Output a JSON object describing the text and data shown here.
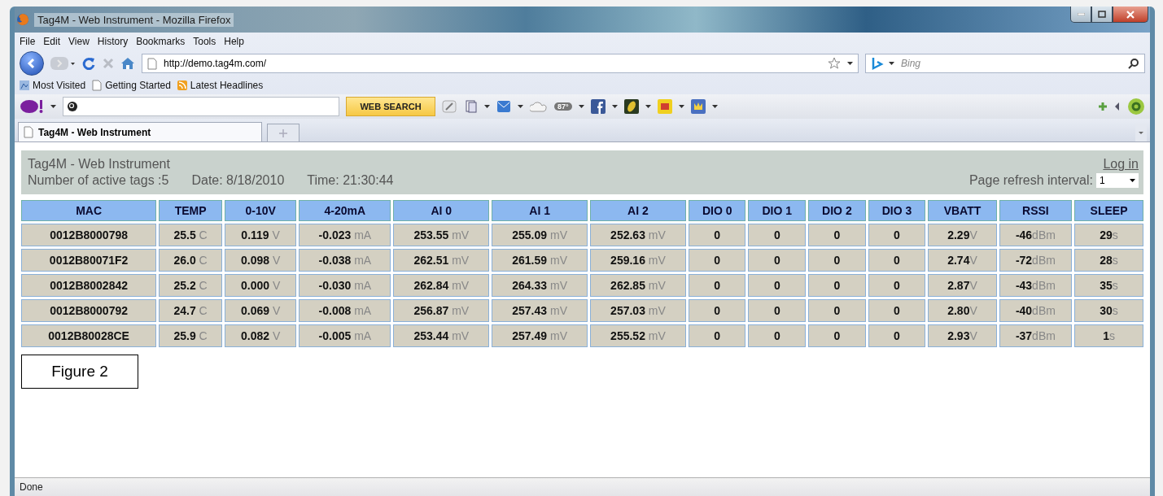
{
  "window": {
    "title": "Tag4M - Web Instrument - Mozilla Firefox"
  },
  "menu": [
    "File",
    "Edit",
    "View",
    "History",
    "Bookmarks",
    "Tools",
    "Help"
  ],
  "navigation": {
    "url": "http://demo.tag4m.com/",
    "search_placeholder": "Bing"
  },
  "bookmarks": [
    "Most Visited",
    "Getting Started",
    "Latest Headlines"
  ],
  "yahoo_toolbar": {
    "search_button": "WEB SEARCH",
    "weather": "87°"
  },
  "tabs": [
    {
      "label": "Tag4M - Web Instrument",
      "selected": true
    }
  ],
  "page": {
    "title": "Tag4M - Web Instrument",
    "active_tags": "Number of active tags :5",
    "date": "Date: 8/18/2010",
    "time": "Time: 21:30:44",
    "login": "Log in",
    "refresh_label": "Page refresh interval:",
    "refresh_value": "1"
  },
  "table": {
    "columns": [
      "MAC",
      "TEMP",
      "0-10V",
      "4-20mA",
      "AI 0",
      "AI 1",
      "AI 2",
      "DIO 0",
      "DIO 1",
      "DIO 2",
      "DIO 3",
      "VBATT",
      "RSSI",
      "SLEEP"
    ],
    "rows": [
      [
        {
          "value": "0012B8000798"
        },
        {
          "value": "25.5",
          "unit": "C"
        },
        {
          "value": "0.119",
          "unit": "V"
        },
        {
          "value": "-0.023",
          "unit": "mA"
        },
        {
          "value": "253.55",
          "unit": "mV"
        },
        {
          "value": "255.09",
          "unit": "mV"
        },
        {
          "value": "252.63",
          "unit": "mV"
        },
        {
          "value": "0"
        },
        {
          "value": "0"
        },
        {
          "value": "0"
        },
        {
          "value": "0"
        },
        {
          "value": "2.29",
          "unit": "V"
        },
        {
          "value": "-46",
          "unit": "dBm"
        },
        {
          "value": "29",
          "unit": "s"
        }
      ],
      [
        {
          "value": "0012B80071F2"
        },
        {
          "value": "26.0",
          "unit": "C"
        },
        {
          "value": "0.098",
          "unit": "V"
        },
        {
          "value": "-0.038",
          "unit": "mA"
        },
        {
          "value": "262.51",
          "unit": "mV"
        },
        {
          "value": "261.59",
          "unit": "mV"
        },
        {
          "value": "259.16",
          "unit": "mV"
        },
        {
          "value": "0"
        },
        {
          "value": "0"
        },
        {
          "value": "0"
        },
        {
          "value": "0"
        },
        {
          "value": "2.74",
          "unit": "V"
        },
        {
          "value": "-72",
          "unit": "dBm"
        },
        {
          "value": "28",
          "unit": "s"
        }
      ],
      [
        {
          "value": "0012B8002842"
        },
        {
          "value": "25.2",
          "unit": "C"
        },
        {
          "value": "0.000",
          "unit": "V"
        },
        {
          "value": "-0.030",
          "unit": "mA"
        },
        {
          "value": "262.84",
          "unit": "mV"
        },
        {
          "value": "264.33",
          "unit": "mV"
        },
        {
          "value": "262.85",
          "unit": "mV"
        },
        {
          "value": "0"
        },
        {
          "value": "0"
        },
        {
          "value": "0"
        },
        {
          "value": "0"
        },
        {
          "value": "2.87",
          "unit": "V"
        },
        {
          "value": "-43",
          "unit": "dBm"
        },
        {
          "value": "35",
          "unit": "s"
        }
      ],
      [
        {
          "value": "0012B8000792"
        },
        {
          "value": "24.7",
          "unit": "C"
        },
        {
          "value": "0.069",
          "unit": "V"
        },
        {
          "value": "-0.008",
          "unit": "mA"
        },
        {
          "value": "256.87",
          "unit": "mV"
        },
        {
          "value": "257.43",
          "unit": "mV"
        },
        {
          "value": "257.03",
          "unit": "mV"
        },
        {
          "value": "0"
        },
        {
          "value": "0"
        },
        {
          "value": "0"
        },
        {
          "value": "0"
        },
        {
          "value": "2.80",
          "unit": "V"
        },
        {
          "value": "-40",
          "unit": "dBm"
        },
        {
          "value": "30",
          "unit": "s"
        }
      ],
      [
        {
          "value": "0012B80028CE"
        },
        {
          "value": "25.9",
          "unit": "C"
        },
        {
          "value": "0.082",
          "unit": "V"
        },
        {
          "value": "-0.005",
          "unit": "mA"
        },
        {
          "value": "253.44",
          "unit": "mV"
        },
        {
          "value": "257.49",
          "unit": "mV"
        },
        {
          "value": "255.52",
          "unit": "mV"
        },
        {
          "value": "0"
        },
        {
          "value": "0"
        },
        {
          "value": "0"
        },
        {
          "value": "0"
        },
        {
          "value": "2.93",
          "unit": "V"
        },
        {
          "value": "-37",
          "unit": "dBm"
        },
        {
          "value": "1",
          "unit": "s"
        }
      ]
    ]
  },
  "figure_label": "Figure 2",
  "status_bar": "Done"
}
